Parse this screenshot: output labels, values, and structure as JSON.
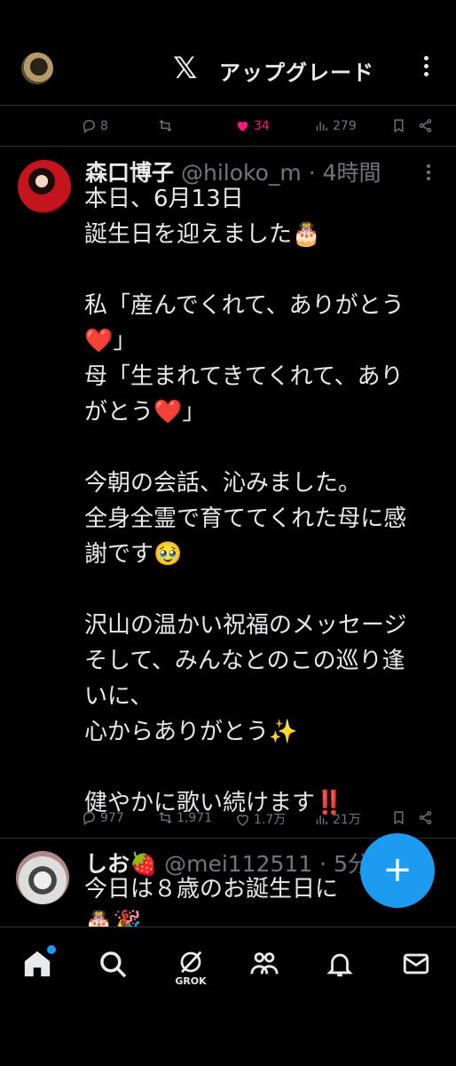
{
  "header": {
    "logo": "𝕏",
    "upgrade_label": "アップグレード"
  },
  "prev_tweet": {
    "reply_count": "8",
    "retweet_count": "",
    "like_count": "34",
    "view_count": "279"
  },
  "tweet": {
    "name": "森口博子",
    "handle": "@hiloko_m",
    "time": "· 4時間",
    "lines": [
      "本日、6月13日",
      "誕生日を迎えました🎂",
      "",
      "私「産んでくれて、ありがとう",
      "❤️」",
      "母「生まれてきてくれて、あり",
      "がとう❤️」",
      "",
      "今朝の会話、沁みました。",
      "全身全霊で育ててくれた母に感",
      "謝です🥹",
      "",
      "沢山の温かい祝福のメッセージ",
      "そして、みんなとのこの巡り逢",
      "いに、",
      "心からありがとう✨",
      "",
      "健やかに歌い続けます‼️"
    ],
    "reply_count": "977",
    "retweet_count": "1,971",
    "like_count": "1.7万",
    "view_count": "21万"
  },
  "next_tweet": {
    "name": "しお🍓",
    "handle": "@mei112511",
    "time": "· 5分",
    "text": "今日は８歳のお誕生日に",
    "text2": "🎂🎉"
  },
  "fab": {
    "label": "+"
  },
  "nav": {
    "grok_label": "GROK"
  },
  "colors": {
    "accent": "#1d9bf0",
    "like": "#f91880",
    "muted": "#71767b"
  }
}
